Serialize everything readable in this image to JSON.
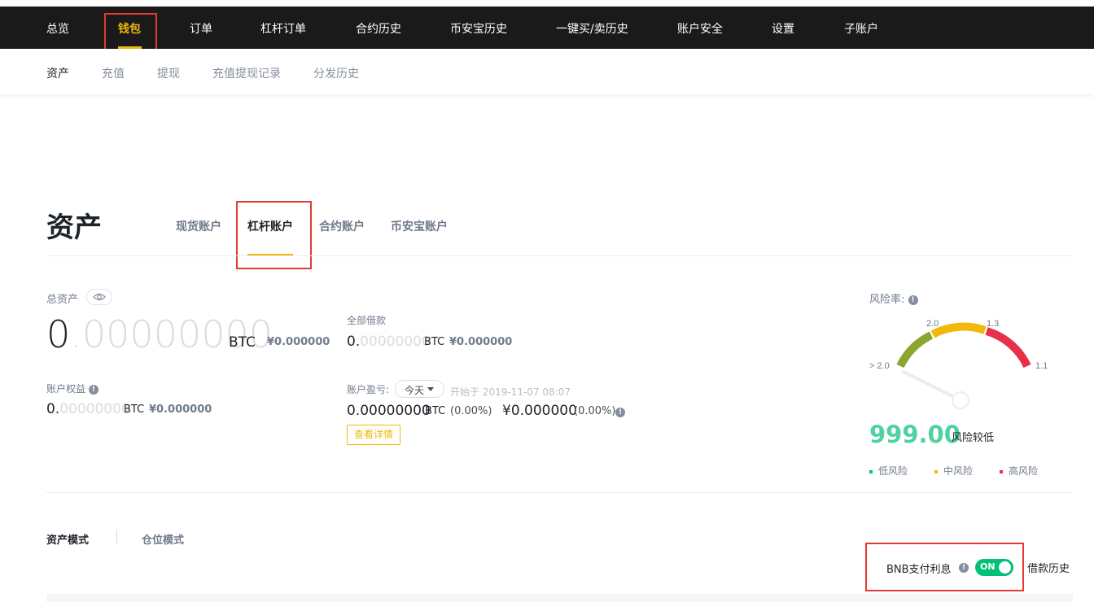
{
  "topnav": {
    "items": [
      {
        "label": "总览"
      },
      {
        "label": "钱包"
      },
      {
        "label": "订单"
      },
      {
        "label": "杠杆订单"
      },
      {
        "label": "合约历史"
      },
      {
        "label": "币安宝历史"
      },
      {
        "label": "一键买/卖历史"
      },
      {
        "label": "账户安全"
      },
      {
        "label": "设置"
      },
      {
        "label": "子账户"
      }
    ],
    "active": "钱包"
  },
  "subnav": {
    "items": [
      {
        "label": "资产"
      },
      {
        "label": "充值"
      },
      {
        "label": "提现"
      },
      {
        "label": "充值提现记录"
      },
      {
        "label": "分发历史"
      }
    ],
    "active": "资产"
  },
  "page": {
    "title": "资产",
    "tabs": [
      {
        "label": "现货账户"
      },
      {
        "label": "杠杆账户"
      },
      {
        "label": "合约账户"
      },
      {
        "label": "币安宝账户"
      }
    ],
    "active_tab": "杠杆账户"
  },
  "total_assets": {
    "label": "总资产",
    "int_part": "0",
    "dec_part": ".00000000",
    "unit": "BTC",
    "cny": "¥0.000000"
  },
  "borrowed": {
    "label": "全部借款",
    "int_part": "0.",
    "dec_part": "00000000",
    "unit": "BTC",
    "cny": "¥0.000000"
  },
  "equity": {
    "label": "账户权益",
    "int_part": "0.",
    "dec_part": "00000000",
    "unit": "BTC",
    "cny": "¥0.000000"
  },
  "pnl": {
    "label": "账户盈亏:",
    "period": "今天",
    "start": "开始于 2019-11-07 08:07",
    "btc_value": "0.00000000",
    "unit": "BTC",
    "btc_pct": "(0.00%)",
    "cny_value": "¥0.000000",
    "cny_pct": "(0.00%)",
    "detail_button": "查看详情"
  },
  "risk": {
    "label": "风险率:",
    "gauge_labels": {
      "gt": "> 2.0",
      "a": "2.0",
      "b": "1.3",
      "c": "1.1"
    },
    "value": "999.00",
    "status": "风险较低",
    "legend": [
      {
        "label": "低风险",
        "color": "#02c076"
      },
      {
        "label": "中风险",
        "color": "#f0b90b"
      },
      {
        "label": "高风险",
        "color": "#e8304a"
      }
    ]
  },
  "modes": {
    "asset_mode": "资产模式",
    "position_mode": "仓位模式"
  },
  "bnb": {
    "label": "BNB支付利息",
    "toggle": "ON",
    "history": "借款历史"
  },
  "colors": {
    "accent": "#f0b90b",
    "nav_bg": "#1a1a1a",
    "green": "#02c076",
    "highlight_box": "#e53935"
  }
}
